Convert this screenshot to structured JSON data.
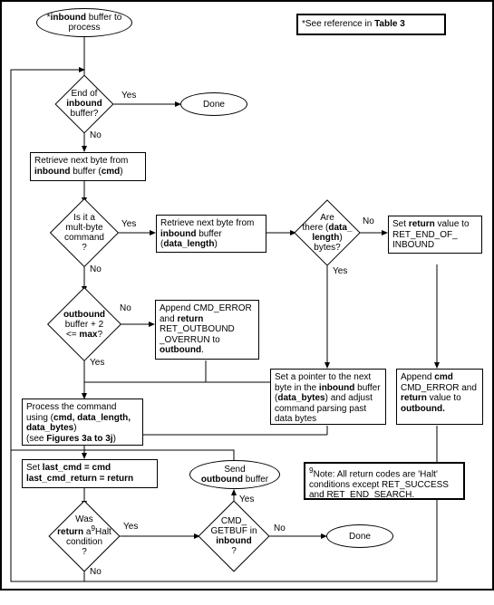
{
  "start": {
    "line1_pre": "*",
    "line1_b": "inbound",
    "line1_post": " buffer to",
    "line2": "process"
  },
  "ref_note": {
    "text1": "*See reference in ",
    "bold": "Table 3"
  },
  "d_end": {
    "l1": "End of",
    "l2_b": "inbound",
    "l3": "buffer?"
  },
  "done1": "Done",
  "done2": "Done",
  "p_retrieve_cmd": {
    "l1": "Retrieve next byte from",
    "l2_b": "inbound",
    "l2_post": " buffer (",
    "l2_b2": "cmd",
    "l2_end": ")"
  },
  "d_multibyte": {
    "l1": "Is it a",
    "l2": "mult-byte",
    "l3": "command",
    "l4": "?"
  },
  "p_retrieve_len": {
    "l1": "Retrieve next byte from",
    "l2_b": "inbound",
    "l2_post": " buffer",
    "l3_pre": "(",
    "l3_b": "data_length",
    "l3_post": ")"
  },
  "d_arethere": {
    "l1": "Are",
    "l2_pre": "there (",
    "l2_b": "data_",
    "l3_b": "length",
    "l3_post": ")",
    "l4": "bytes?"
  },
  "p_setreturn": {
    "l1_pre": "Set ",
    "l1_b": "return",
    "l1_post": " value to",
    "l2": "RET_END_OF_",
    "l3": "INBOUND"
  },
  "d_outbound": {
    "l1_b": "outbound",
    "l2": "buffer + 2",
    "l3_pre": "<= ",
    "l3_b": "max",
    "l3_post": "?"
  },
  "p_appenderr": {
    "l1": "Append CMD_ERROR",
    "l2_pre": "and ",
    "l2_b": "return",
    "l3": "RET_OUTBOUND",
    "l4": "_OVERRUN to",
    "l5_b": "outbound",
    "l5_post": "."
  },
  "p_setpointer": {
    "l1": "Set a pointer to the next",
    "l2_pre": "byte in the ",
    "l2_b": "inbound",
    "l2_post": " buffer",
    "l3_pre": "(",
    "l3_b": "data_bytes",
    "l3_post": ") and adjust",
    "l4": "command parsing past",
    "l5": "data bytes"
  },
  "p_append2": {
    "l1_pre": "Append ",
    "l1_b": "cmd",
    "l2": "CMD_ERROR and",
    "l3_b": "return",
    "l3_post": " value to",
    "l4_b": "outbound."
  },
  "p_process": {
    "l1": "Process the command",
    "l2_pre": "using (",
    "l2_b": "cmd, data_length,",
    "l3_b": "data_bytes",
    "l3_post": ")",
    "l4_pre": "(see ",
    "l4_b": "Figures 3a to 3j",
    "l4_post": ")"
  },
  "p_setlast": {
    "l1_pre": "Set ",
    "l1_b": "last_cmd = cmd",
    "l2_b": "last_cmd_return = return"
  },
  "e_send": {
    "l1": "Send",
    "l2_b": "outbound",
    "l2_post": " buffer"
  },
  "note2": {
    "sup": "9",
    "l1": "Note: All return codes are 'Halt'",
    "l2": "conditions except RET_SUCCESS",
    "l3": "and RET_END_SEARCH."
  },
  "d_washalt": {
    "l1": "Was",
    "l2_b": "return",
    "l2_post": " a",
    "l2_sup": "9",
    "l2_post2": "Halt",
    "l3": "condition",
    "l4": "?"
  },
  "d_getbuf": {
    "l1": "CMD_",
    "l2": "GETBUF in",
    "l3_b": "inbound",
    "l4": "?"
  },
  "labels": {
    "yes": "Yes",
    "no": "No"
  }
}
